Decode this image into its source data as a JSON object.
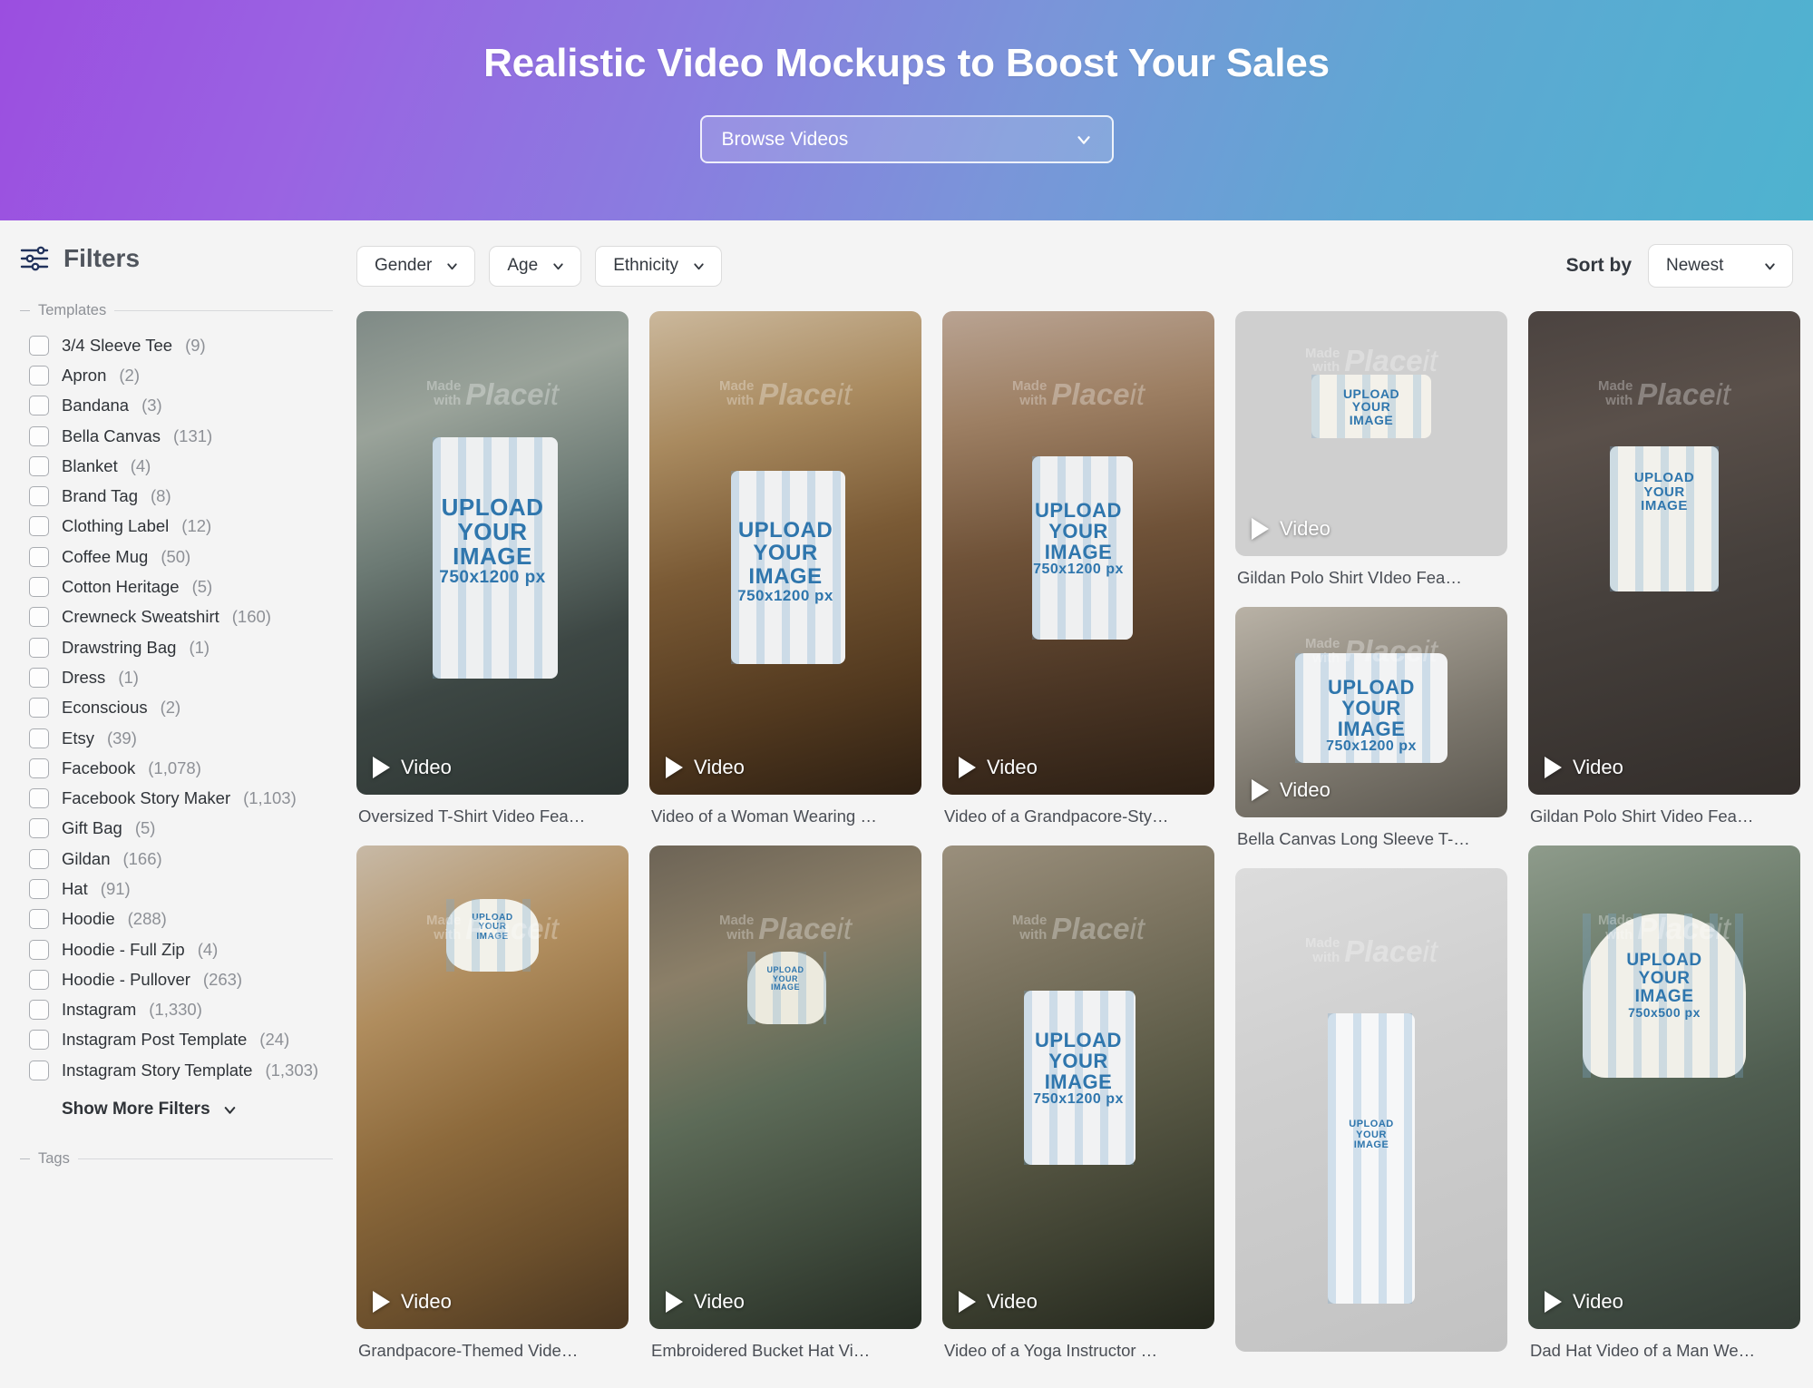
{
  "hero": {
    "title": "Realistic Video Mockups to Boost Your Sales",
    "browse_label": "Browse Videos",
    "gradient_from": "#9b4ee0",
    "gradient_to": "#4eb3cf"
  },
  "sidebar": {
    "filters_title": "Filters",
    "sections": {
      "templates_label": "Templates",
      "tags_label": "Tags"
    },
    "show_more_label": "Show More Filters",
    "templates": [
      {
        "label": "3/4 Sleeve Tee",
        "count": "(9)"
      },
      {
        "label": "Apron",
        "count": "(2)"
      },
      {
        "label": "Bandana",
        "count": "(3)"
      },
      {
        "label": "Bella Canvas",
        "count": "(131)"
      },
      {
        "label": "Blanket",
        "count": "(4)"
      },
      {
        "label": "Brand Tag",
        "count": "(8)"
      },
      {
        "label": "Clothing Label",
        "count": "(12)"
      },
      {
        "label": "Coffee Mug",
        "count": "(50)"
      },
      {
        "label": "Cotton Heritage",
        "count": "(5)"
      },
      {
        "label": "Crewneck Sweatshirt",
        "count": "(160)"
      },
      {
        "label": "Drawstring Bag",
        "count": "(1)"
      },
      {
        "label": "Dress",
        "count": "(1)"
      },
      {
        "label": "Econscious",
        "count": "(2)"
      },
      {
        "label": "Etsy",
        "count": "(39)"
      },
      {
        "label": "Facebook",
        "count": "(1,078)"
      },
      {
        "label": "Facebook Story Maker",
        "count": "(1,103)"
      },
      {
        "label": "Gift Bag",
        "count": "(5)"
      },
      {
        "label": "Gildan",
        "count": "(166)"
      },
      {
        "label": "Hat",
        "count": "(91)"
      },
      {
        "label": "Hoodie",
        "count": "(288)"
      },
      {
        "label": "Hoodie - Full Zip",
        "count": "(4)"
      },
      {
        "label": "Hoodie - Pullover",
        "count": "(263)"
      },
      {
        "label": "Instagram",
        "count": "(1,330)"
      },
      {
        "label": "Instagram Post Template",
        "count": "(24)"
      },
      {
        "label": "Instagram Story Template",
        "count": "(1,303)"
      }
    ]
  },
  "toolbar": {
    "filters": [
      {
        "label": "Gender"
      },
      {
        "label": "Age"
      },
      {
        "label": "Ethnicity"
      }
    ],
    "sort_by_label": "Sort by",
    "sort_value": "Newest"
  },
  "grid": {
    "video_badge_label": "Video",
    "watermark": {
      "made": "Made",
      "with": "with",
      "brand": "Place",
      "brand_it": "it"
    },
    "upload_text": {
      "l1": "UPLOAD",
      "l2": "YOUR",
      "l3": "IMAGE",
      "px_1200": "750x1200 px",
      "px_500": "750x500 px"
    },
    "columns": [
      {
        "cards": [
          {
            "title": "Oversized T-Shirt Video Fea…",
            "badge": "Video"
          },
          {
            "title": "Grandpacore-Themed Vide…",
            "badge": "Video"
          }
        ]
      },
      {
        "cards": [
          {
            "title": "Video of a Woman Wearing …",
            "badge": "Video"
          },
          {
            "title": "Embroidered Bucket Hat Vi…",
            "badge": "Video"
          }
        ]
      },
      {
        "cards": [
          {
            "title": "Video of a Grandpacore-Sty…",
            "badge": "Video"
          },
          {
            "title": "Video of a Yoga Instructor …",
            "badge": "Video"
          }
        ]
      },
      {
        "cards": [
          {
            "title": "Gildan Polo Shirt VIdeo Fea…",
            "badge": "Video"
          },
          {
            "title": "Bella Canvas Long Sleeve T-…",
            "badge": "Video"
          },
          {
            "title": "",
            "badge": ""
          }
        ]
      },
      {
        "cards": [
          {
            "title": "Gildan Polo Shirt Video Fea…",
            "badge": "Video"
          },
          {
            "title": "Dad Hat Video of a Man We…",
            "badge": "Video"
          }
        ]
      }
    ]
  }
}
